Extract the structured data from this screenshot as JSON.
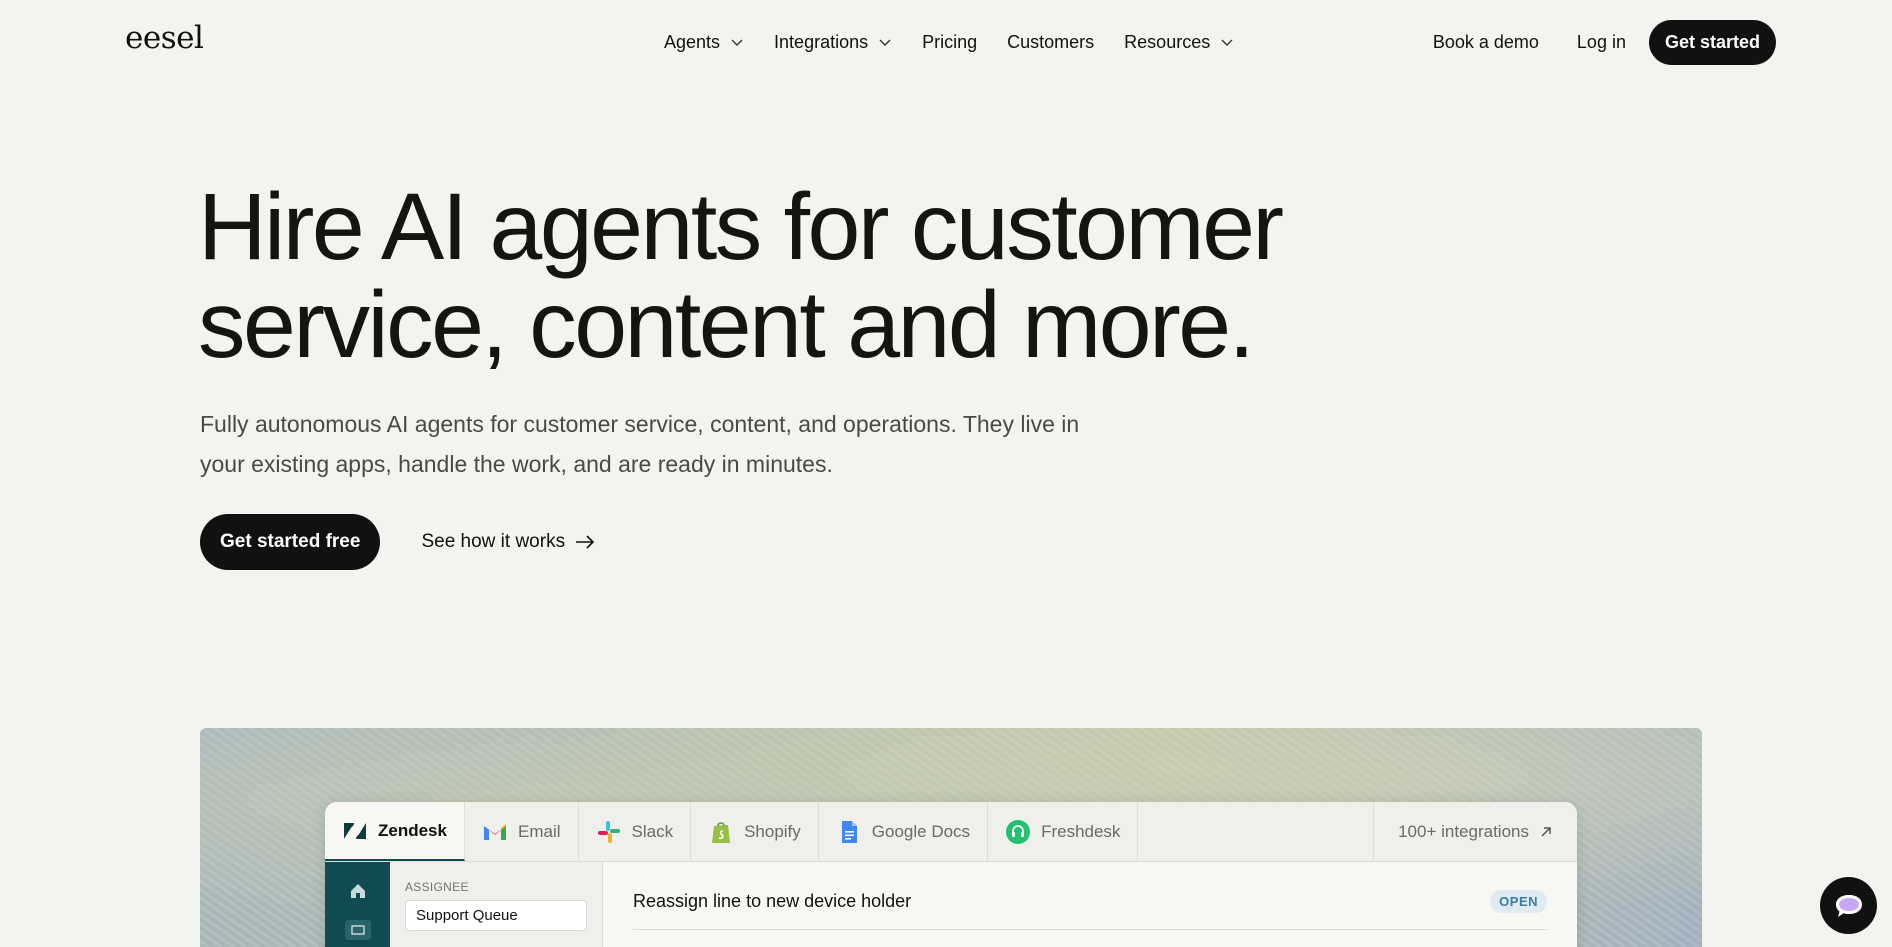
{
  "nav": {
    "logo": "eesel",
    "links": [
      {
        "label": "Agents",
        "dropdown": true
      },
      {
        "label": "Integrations",
        "dropdown": true
      },
      {
        "label": "Pricing",
        "dropdown": false
      },
      {
        "label": "Customers",
        "dropdown": false
      },
      {
        "label": "Resources",
        "dropdown": true
      }
    ],
    "book_demo": "Book a demo",
    "login": "Log in",
    "get_started": "Get started"
  },
  "hero": {
    "title_line1": "Hire AI agents for customer",
    "title_line2": "service, content and more.",
    "subtitle_line1": "Fully autonomous AI agents for customer service, content, and operations. They live in",
    "subtitle_line2": "your existing apps, handle the work, and are ready in minutes.",
    "cta_primary": "Get started free",
    "cta_secondary": "See how it works"
  },
  "demo": {
    "tabs": [
      {
        "label": "Zendesk",
        "icon": "zendesk-icon"
      },
      {
        "label": "Email",
        "icon": "gmail-icon"
      },
      {
        "label": "Slack",
        "icon": "slack-icon"
      },
      {
        "label": "Shopify",
        "icon": "shopify-icon"
      },
      {
        "label": "Google Docs",
        "icon": "google-docs-icon"
      },
      {
        "label": "Freshdesk",
        "icon": "freshdesk-icon"
      }
    ],
    "integrations_link": "100+ integrations",
    "assignee_label": "ASSIGNEE",
    "assignee_value": "Support Queue",
    "ticket_title": "Reassign line to new device holder",
    "ticket_status": "OPEN"
  },
  "colors": {
    "page_bg": "#f3f3ef",
    "primary_dark": "#111111",
    "rail_teal": "#0f4b50",
    "status_blue": "#3a7ea8"
  }
}
